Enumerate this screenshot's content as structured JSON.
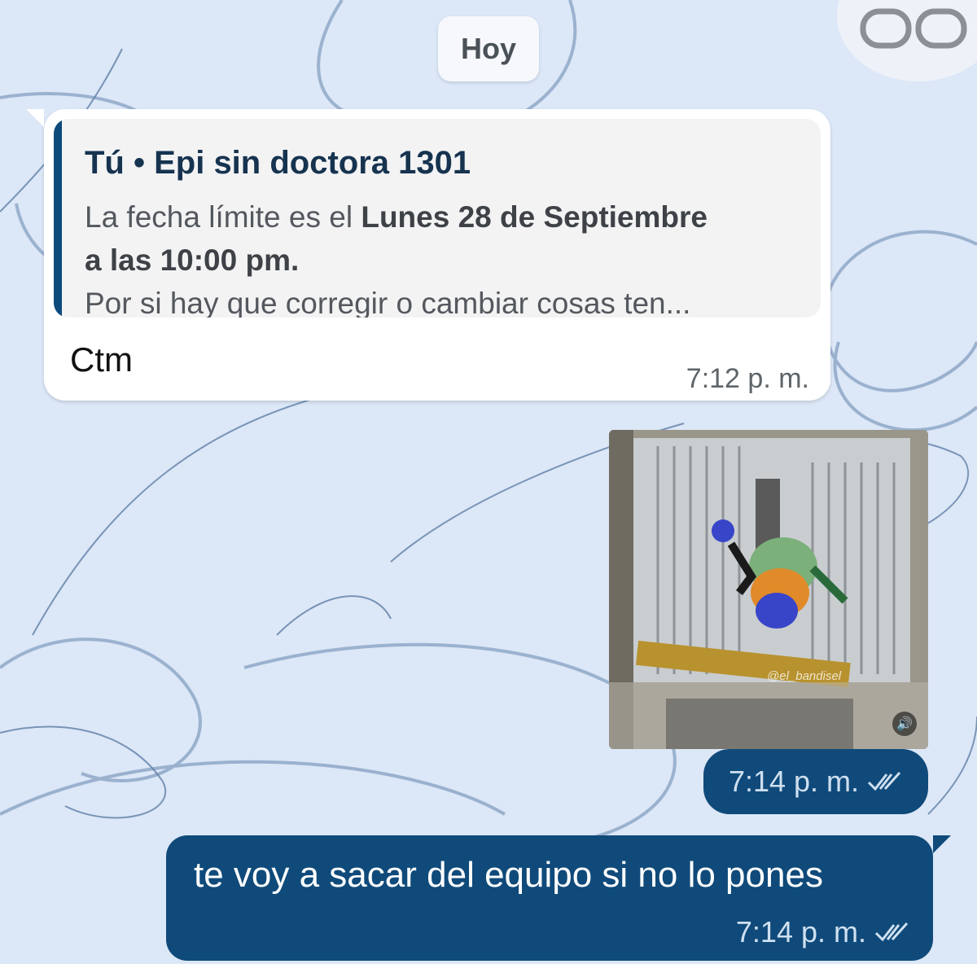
{
  "date_chip": "Hoy",
  "messages": {
    "incoming": {
      "quote_header": "Tú • Epi sin doctora 1301",
      "quote_line1_plain": "La fecha límite es el ",
      "quote_line1_bold": "Lunes 28 de Septiembre",
      "quote_line2_bold": "a las 10:00 pm.",
      "quote_line3": "Por si hay que corregir o cambiar cosas ten...",
      "text": "Ctm",
      "time": "7:12 p. m."
    },
    "media": {
      "watermark": "@el_bandisel",
      "time": "7:14 p. m."
    },
    "outgoing": {
      "text": "te voy a sacar del equipo si no lo pones",
      "time": "7:14 p. m."
    }
  },
  "colors": {
    "background": "#dce7f7",
    "outgoing_bubble": "#0f4a7a",
    "quote_bar": "#0d4a7c",
    "incoming_bubble": "#ffffff"
  },
  "icons": [
    "view-once-icon",
    "double-check-icon",
    "volume-icon"
  ]
}
